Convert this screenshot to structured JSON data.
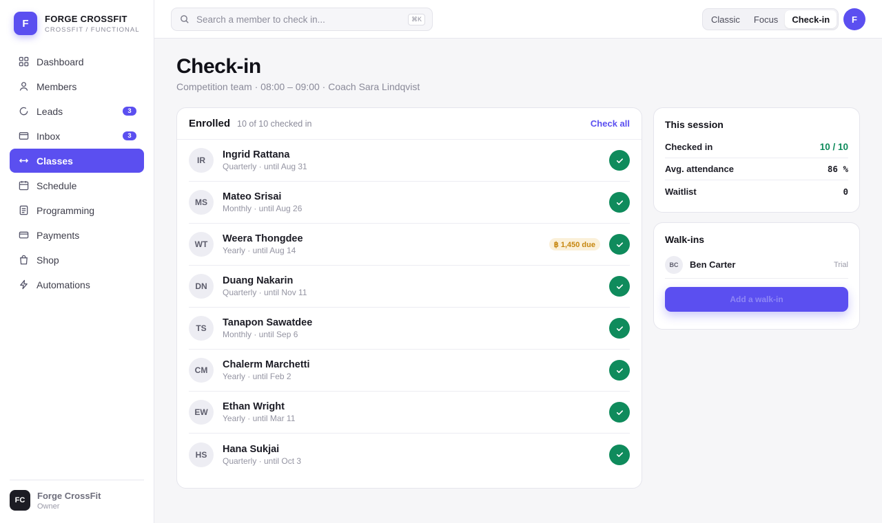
{
  "colors": {
    "accent": "#5b4ff0",
    "success": "#0f8b5c",
    "due_bg": "#fbf0d9",
    "due_text": "#c6860f"
  },
  "brand": {
    "logo_letter": "F",
    "name": "FORGE CROSSFIT",
    "subtitle": "CROSSFIT / FUNCTIONAL"
  },
  "sidebar": {
    "items": [
      {
        "label": "Dashboard",
        "icon": "grid-icon"
      },
      {
        "label": "Members",
        "icon": "user-icon"
      },
      {
        "label": "Leads",
        "icon": "refresh-icon",
        "badge": "3"
      },
      {
        "label": "Inbox",
        "icon": "inbox-icon",
        "badge": "3"
      },
      {
        "label": "Classes",
        "icon": "arrows-icon",
        "active": true
      },
      {
        "label": "Schedule",
        "icon": "calendar-icon"
      },
      {
        "label": "Programming",
        "icon": "document-icon"
      },
      {
        "label": "Payments",
        "icon": "card-icon"
      },
      {
        "label": "Shop",
        "icon": "bag-icon"
      },
      {
        "label": "Automations",
        "icon": "bolt-icon"
      }
    ],
    "owner": {
      "initials": "FC",
      "name": "Forge CrossFit",
      "role": "Owner"
    }
  },
  "topbar": {
    "search_placeholder": "Search a member to check in...",
    "shortcut": "⌘K",
    "modes": [
      "Classic",
      "Focus",
      "Check-in"
    ],
    "active_mode": "Check-in",
    "user_initial": "F"
  },
  "page": {
    "title": "Check-in",
    "subtitle": "Competition team · 08:00 – 09:00 · Coach Sara Lindqvist"
  },
  "enrolled": {
    "title": "Enrolled",
    "count_text": "10 of 10 checked in",
    "check_all_label": "Check all",
    "members": [
      {
        "initials": "IR",
        "name": "Ingrid Rattana",
        "plan": "Quarterly · until Aug 31",
        "checked": true
      },
      {
        "initials": "MS",
        "name": "Mateo Srisai",
        "plan": "Monthly · until Aug 26",
        "checked": true
      },
      {
        "initials": "WT",
        "name": "Weera Thongdee",
        "plan": "Yearly · until Aug 14",
        "due": "฿ 1,450 due",
        "checked": true
      },
      {
        "initials": "DN",
        "name": "Duang Nakarin",
        "plan": "Quarterly · until Nov 11",
        "checked": true
      },
      {
        "initials": "TS",
        "name": "Tanapon Sawatdee",
        "plan": "Monthly · until Sep 6",
        "checked": true
      },
      {
        "initials": "CM",
        "name": "Chalerm Marchetti",
        "plan": "Yearly · until Feb 2",
        "checked": true
      },
      {
        "initials": "EW",
        "name": "Ethan Wright",
        "plan": "Yearly · until Mar 11",
        "checked": true
      },
      {
        "initials": "HS",
        "name": "Hana Sukjai",
        "plan": "Quarterly · until Oct 3",
        "checked": true
      }
    ]
  },
  "session": {
    "title": "This session",
    "stats": [
      {
        "label": "Checked in",
        "value": "10 / 10",
        "highlight": true
      },
      {
        "label": "Avg. attendance",
        "value": "86 %"
      },
      {
        "label": "Waitlist",
        "value": "0"
      }
    ]
  },
  "walkins": {
    "title": "Walk-ins",
    "items": [
      {
        "initials": "BC",
        "name": "Ben Carter",
        "tag": "Trial"
      }
    ],
    "add_label": "Add a walk-in"
  }
}
